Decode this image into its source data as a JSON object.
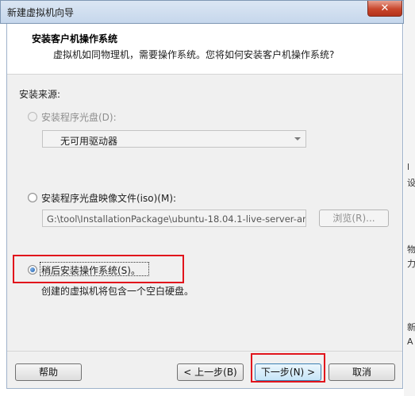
{
  "window": {
    "title": "新建虚拟机向导",
    "close_glyph": "✕"
  },
  "header": {
    "title": "安装客户机操作系统",
    "subtitle": "虚拟机如同物理机，需要操作系统。您将如何安装客户机操作系统?"
  },
  "install_source": {
    "label": "安装来源:",
    "disc_option": {
      "label": "安装程序光盘(D):",
      "selected": false,
      "enabled": false,
      "drive_value": "无可用驱动器"
    },
    "iso_option": {
      "label": "安装程序光盘映像文件(iso)(M):",
      "selected": false,
      "path_value": "G:\\tool\\InstallationPackage\\ubuntu-18.04.1-live-server-an",
      "browse_label": "浏览(R)..."
    },
    "later_option": {
      "label": "稍后安装操作系统(S)。",
      "selected": true,
      "description": "创建的虚拟机将包含一个空白硬盘。"
    }
  },
  "footer": {
    "help_label": "帮助",
    "back_label": "< 上一步(B)",
    "next_label": "下一步(N) >",
    "cancel_label": "取消"
  },
  "background_glyphs": [
    "l",
    "设",
    "物",
    "力",
    "新",
    "A"
  ],
  "colors": {
    "highlight": "#e1141c",
    "radio_selected": "#1d5ba8"
  }
}
